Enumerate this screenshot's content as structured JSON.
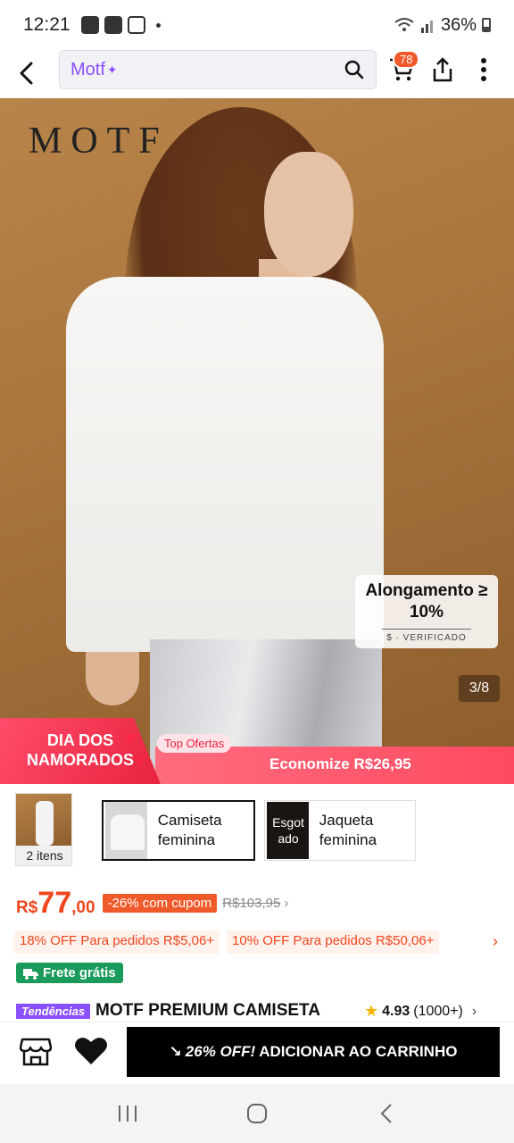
{
  "status_bar": {
    "time": "12:21",
    "battery": "36%"
  },
  "search": {
    "query": "Motf",
    "cart_count": "78"
  },
  "hero": {
    "brand": "MOTF",
    "stretch_text": "Alongamento ≥ 10%",
    "verified": "$ · VERIFICADO",
    "page_indicator": "3/8"
  },
  "promo": {
    "title": "DIA DOS NAMORADOS",
    "top_tag": "Top Ofertas",
    "savings": "Economize R$26,95"
  },
  "variants": {
    "all_count": "2 itens",
    "items": [
      {
        "label": "Camiseta feminina",
        "selected": true
      },
      {
        "label": "Jaqueta feminina",
        "sold_out_label": "Esgot ado"
      }
    ]
  },
  "price": {
    "currency": "R$",
    "integer": "77",
    "decimal": ",00",
    "coupon": "-26% com cupom",
    "old_price": "R$103,95"
  },
  "discounts": [
    "18% OFF Para pedidos R$5,06+",
    "10% OFF Para pedidos R$50,06+"
  ],
  "shipping": {
    "free": "Frete grátis"
  },
  "product": {
    "trend_tag": "Tendências",
    "title": "MOTF PREMIUM CAMISETA",
    "rating": "4.93",
    "reviews": "(1000+)"
  },
  "action_bar": {
    "promo": "26% OFF!",
    "add_label": "ADICIONAR AO CARRINHO"
  },
  "colors": {
    "accent": "#f0471f",
    "brand_purple": "#8a4fff",
    "ship_green": "#1a9b5b"
  }
}
